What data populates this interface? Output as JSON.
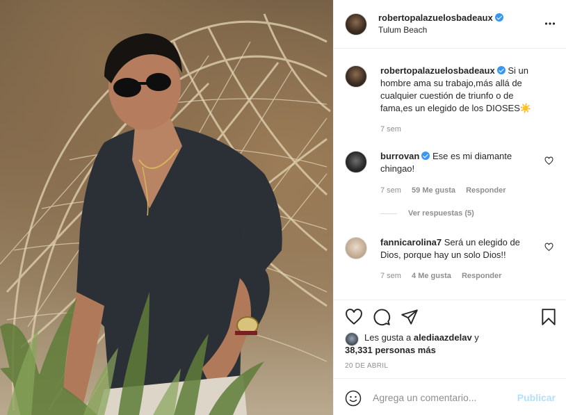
{
  "post": {
    "image_alt": "Man in dark shirt and sunglasses posing in front of a woven wicker structure at the beach"
  },
  "header": {
    "username": "robertopalazuelosbadeaux",
    "location": "Tulum Beach"
  },
  "caption": {
    "username": "robertopalazuelosbadeaux",
    "text": "Si un hombre ama su trabajo,más allá de cualquier cuestión de triunfo o de fama,es un elegido de los DIOSES☀️",
    "time": "7 sem"
  },
  "comments": [
    {
      "username": "burrovan",
      "text": "Ese es mi diamante chingao!",
      "time": "7 sem",
      "likes": "59 Me gusta",
      "reply": "Responder",
      "view_replies": "Ver respuestas (5)"
    },
    {
      "username": "fannicarolina7",
      "text": "Será un elegido de Dios, porque hay un solo Dios!!",
      "time": "7 sem",
      "likes": "4 Me gusta",
      "reply": "Responder"
    }
  ],
  "likes": {
    "prefix": "Les gusta a",
    "user": "alediaazdelav",
    "connector": "y",
    "count": "38,331 personas más"
  },
  "date": "20 DE ABRIL",
  "add_comment": {
    "placeholder": "Agrega un comentario...",
    "publish_label": "Publicar"
  },
  "colors": {
    "verified": "#3897f0",
    "publish_disabled": "#b2dffc",
    "meta_text": "#8e8e8e"
  },
  "icons": [
    "more-icon",
    "heart-icon",
    "comment-icon",
    "share-icon",
    "bookmark-icon",
    "emoji-icon",
    "verified-badge-icon"
  ]
}
